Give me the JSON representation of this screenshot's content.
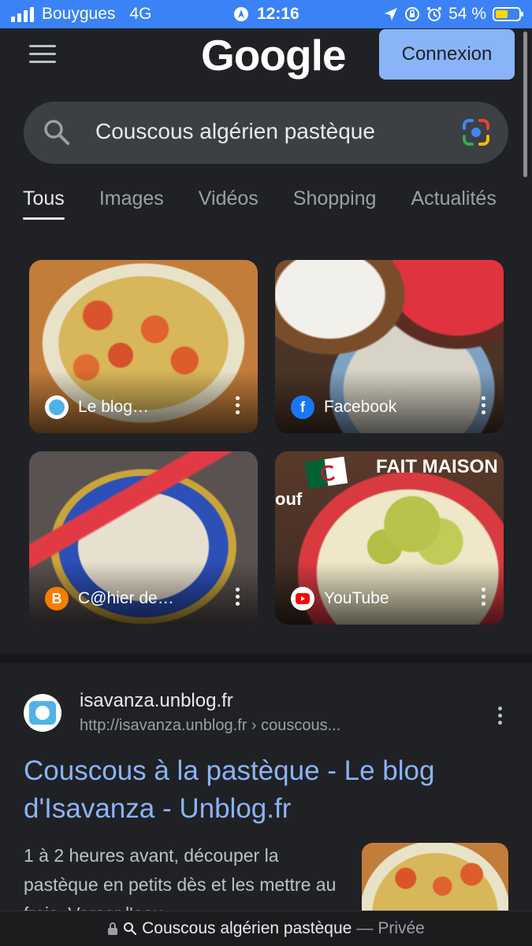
{
  "status_bar": {
    "carrier": "Bouygues",
    "network": "4G",
    "time": "12:16",
    "battery": "54 %",
    "battery_level": 0.54
  },
  "header": {
    "logo": "Google",
    "signin_label": "Connexion"
  },
  "search": {
    "query": "Couscous algérien pastèque"
  },
  "tabs": [
    {
      "label": "Tous",
      "active": true
    },
    {
      "label": "Images"
    },
    {
      "label": "Vidéos"
    },
    {
      "label": "Shopping"
    },
    {
      "label": "Actualités"
    }
  ],
  "image_results": [
    {
      "source": "Le blog…"
    },
    {
      "source": "Facebook"
    },
    {
      "source": "C@hier de…"
    },
    {
      "source": "YouTube",
      "overlay_text": "FAIT MAISON",
      "overlay_side": "ouf"
    }
  ],
  "result": {
    "site": "isavanza.unblog.fr",
    "url": "http://isavanza.unblog.fr › couscous...",
    "title": "Couscous à la pastèque - Le blog d'Isavanza - Unblog.fr",
    "snippet": "1 à 2 heures avant, découper la pastèque en petits dès et les mettre au frais. Verser l'eau"
  },
  "bottom_bar": {
    "query": "Couscous algérien pastèque",
    "separator": "—",
    "mode": "Privée"
  }
}
